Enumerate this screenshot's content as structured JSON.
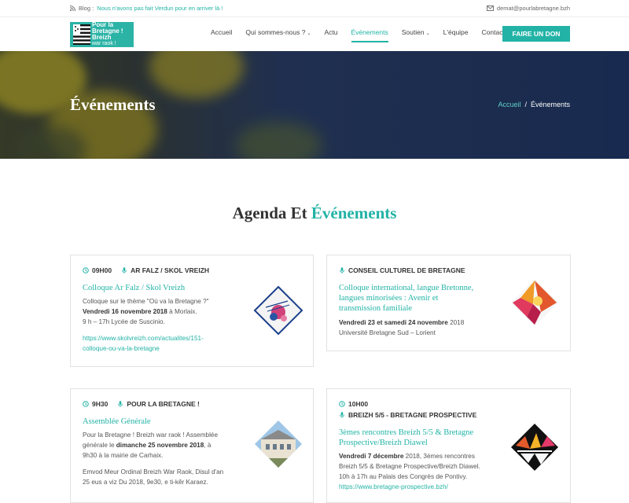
{
  "topbar": {
    "blog_label": "Blog :",
    "blog_link": "Nous n'avons pas fait Verdun pour en arriver là !",
    "email": "demat@pourlabretagne.bzh"
  },
  "logo": {
    "line1": "Pour la",
    "line2": "Bretagne !",
    "line3": "Breizh",
    "line4": "war raok !"
  },
  "nav": {
    "items": [
      {
        "label": "Accueil"
      },
      {
        "label": "Qui sommes-nous ?",
        "chevron": "⌄"
      },
      {
        "label": "Actu"
      },
      {
        "label": "Événements"
      },
      {
        "label": "Soutien",
        "chevron": "⌄"
      },
      {
        "label": "L'équipe"
      },
      {
        "label": "Contact"
      }
    ],
    "cta": "FAIRE UN DON"
  },
  "hero": {
    "title": "Événements",
    "breadcrumb_home": "Accueil",
    "breadcrumb_sep": "/",
    "breadcrumb_current": "Événements"
  },
  "section": {
    "title_plain": "Agenda Et",
    "title_highlight": "Événements"
  },
  "events": [
    {
      "time": "09H00",
      "organizer": "AR FALZ / SKOL VREIZH",
      "title": "Colloque Ar Falz / Skol Vreizh",
      "p1a": "Colloque sur le thème \"Où va la Bretagne ?\"",
      "p1b_bold": "Vendredi 16 novembre 2018",
      "p1c": " à Morlaix.",
      "p2": "9 h – 17h  Lycée de Suscinio.",
      "link1": "https://www.skolvreizh.com/actualites/151-",
      "link2": "colloque-ou-va-la-bretagne"
    },
    {
      "time": "",
      "organizer": "CONSEIL CULTUREL DE BRETAGNE",
      "title1": "Colloque international, langue Bretonne,",
      "title2": "langues minorisées : Avenir et",
      "title3": "transmission familiale",
      "p1_bold": "Vendredi 23 et samedi 24 novembre",
      "p1_rest": " 2018",
      "p2": "Université Bretagne Sud – Lorient"
    },
    {
      "time": "9H30",
      "organizer": "POUR LA BRETAGNE !",
      "title": "Assemblée Générale",
      "l1": "Pour la Bretagne ! Breizh war raok ! Assemblée",
      "l2a": "générale le ",
      "l2b_bold": "dimanche 25 novembre 2018",
      "l2c": ", à",
      "l3": "9h30 à la mairie de Carhaix.",
      "l4": "Emvod Meur Ordinal Breizh War Raok,  Disul d'an",
      "l5": "25 eus a viz Du 2018, 9e30, e ti-kêr Karaez."
    },
    {
      "time": "10H00",
      "organizer": "BREIZH 5/5 - BRETAGNE PROSPECTIVE",
      "title1": "3èmes rencontres Breizh 5/5 & Bretagne",
      "title2": "Prospective/Breizh Diawel",
      "l1_bold": "Vendredi 7 décembre",
      "l1_rest": " 2018, 3èmes rencontres",
      "l2": "Breizh 5/5 & Bretagne Prospective/Breizh Diawel.",
      "l3": "10h à 17h au Palais des Congrès de Pontivy.",
      "link": "https://www.bretagne-prospective.bzh/"
    }
  ],
  "colors": {
    "accent": "#22b3a6"
  }
}
